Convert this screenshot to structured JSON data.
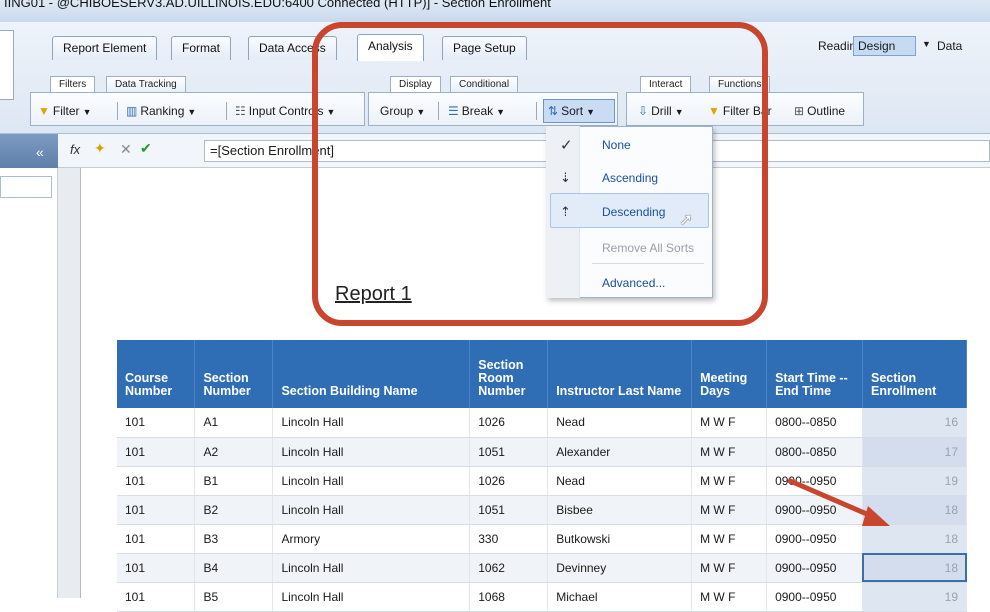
{
  "window": {
    "title": "IING01 - @CHIBOESERV3.AD.UILLINOIS.EDU:6400 Connected (HTTP)]  - Section Enrollment"
  },
  "main_tabs": [
    {
      "label": "Report Element"
    },
    {
      "label": "Format"
    },
    {
      "label": "Data Access"
    },
    {
      "label": "Analysis",
      "active": true
    },
    {
      "label": "Page Setup"
    }
  ],
  "view_modes": {
    "reading": "Reading",
    "design": "Design",
    "data": "Data"
  },
  "sub_tabs": {
    "left": [
      "Filters",
      "Data Tracking"
    ],
    "middle": [
      "Display",
      "Conditional"
    ],
    "right": [
      "Interact",
      "Functions"
    ]
  },
  "toolbar": {
    "filter": "Filter",
    "ranking": "Ranking",
    "input_controls": "Input Controls",
    "group": "Group",
    "break": "Break",
    "sort": "Sort",
    "drill": "Drill",
    "filter_bar": "Filter Bar",
    "outline": "Outline"
  },
  "formula": {
    "value": "=[Section Enrollment]"
  },
  "sort_menu": {
    "items": [
      {
        "label": "None",
        "icon": "check-icon",
        "checked": true
      },
      {
        "label": "Ascending",
        "icon": "sort-ascending-icon"
      },
      {
        "label": "Descending",
        "icon": "sort-descending-icon",
        "hovered": true
      },
      {
        "label": "Remove All Sorts",
        "disabled": true
      },
      {
        "label": "Advanced..."
      }
    ]
  },
  "report": {
    "title": "Report 1",
    "columns": [
      "Course Number",
      "Section Number",
      "Section Building Name",
      "Section Room Number",
      "Instructor Last Name",
      "Meeting Days",
      "Start Time -- End Time",
      "Section Enrollment"
    ],
    "rows": [
      [
        "101",
        "A1",
        "Lincoln Hall",
        "1026",
        "Nead",
        "M W F",
        "0800--0850",
        "16"
      ],
      [
        "101",
        "A2",
        "Lincoln Hall",
        "1051",
        "Alexander",
        "M W F",
        "0800--0850",
        "17"
      ],
      [
        "101",
        "B1",
        "Lincoln Hall",
        "1026",
        "Nead",
        "M W F",
        "0900--0950",
        "19"
      ],
      [
        "101",
        "B2",
        "Lincoln Hall",
        "1051",
        "Bisbee",
        "M W F",
        "0900--0950",
        "18"
      ],
      [
        "101",
        "B3",
        "Armory",
        "330",
        "Butkowski",
        "M W F",
        "0900--0950",
        "18"
      ],
      [
        "101",
        "B4",
        "Lincoln Hall",
        "1062",
        "Devinney",
        "M W F",
        "0900--0950",
        "18"
      ],
      [
        "101",
        "B5",
        "Lincoln Hall",
        "1068",
        "Michael",
        "M W F",
        "0900--0950",
        "19"
      ]
    ]
  },
  "colors": {
    "header_blue": "#2f6eb5",
    "annotation_red": "#c8452e"
  }
}
